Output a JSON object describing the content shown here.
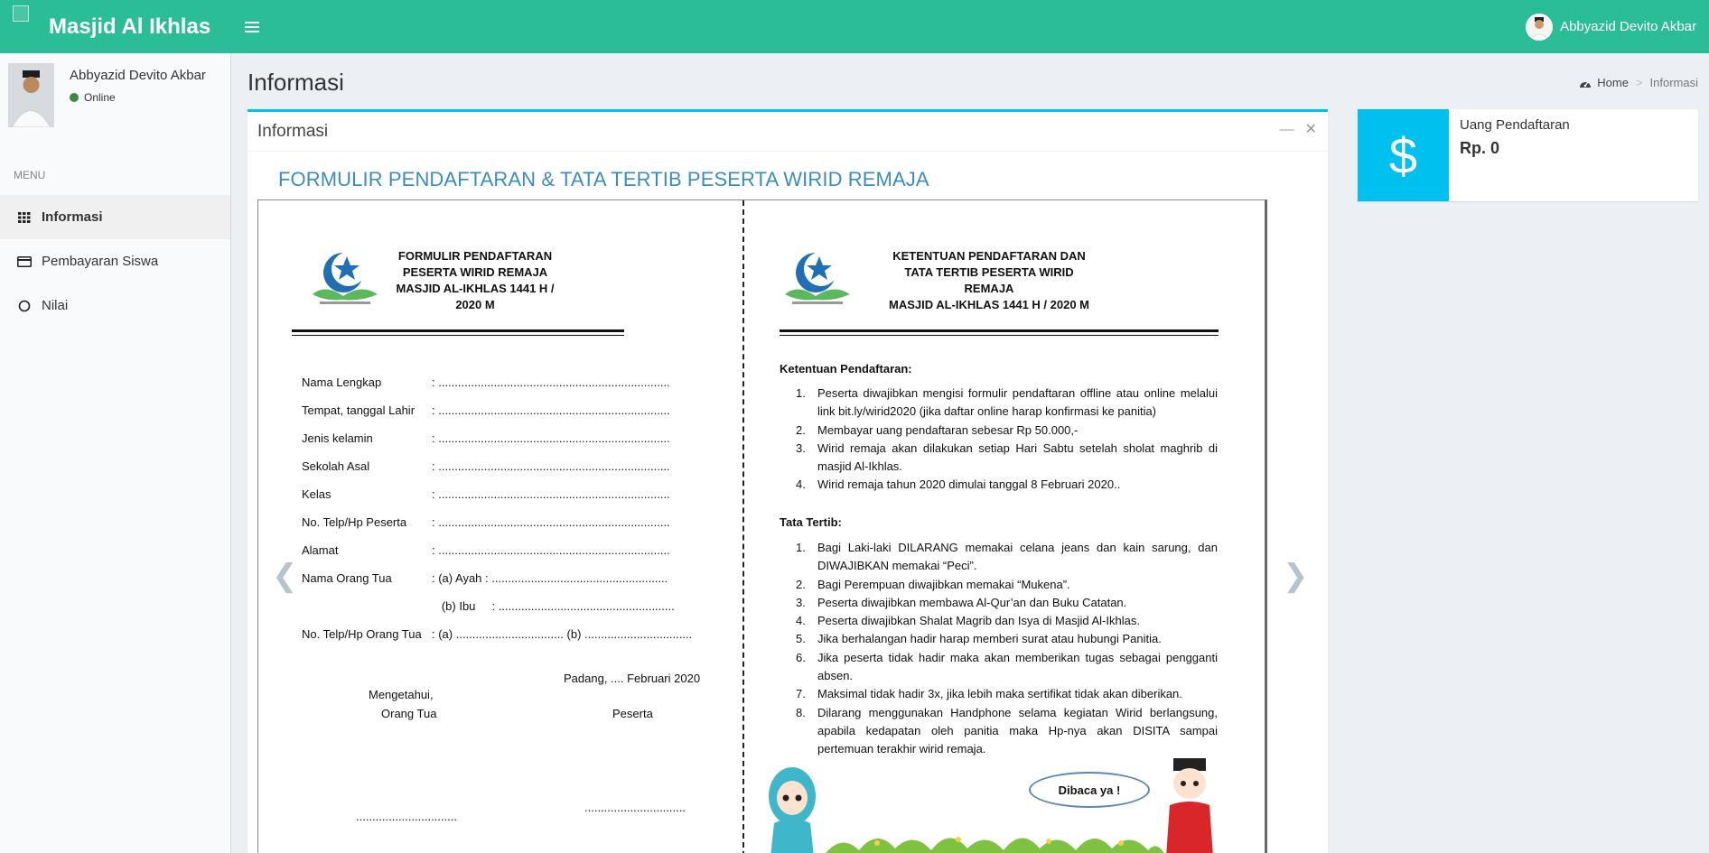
{
  "app": {
    "title": "Masjid Al Ikhlas"
  },
  "navbar": {
    "user_name": "Abbyazid Devito Akbar"
  },
  "sidebar": {
    "user_name": "Abbyazid Devito Akbar",
    "status": "Online",
    "menu_header": "MENU",
    "items": [
      {
        "label": "Informasi",
        "icon": "grid-icon",
        "active": true
      },
      {
        "label": "Pembayaran Siswa",
        "icon": "credit-card-icon",
        "active": false
      },
      {
        "label": "Nilai",
        "icon": "circle-icon",
        "active": false
      }
    ]
  },
  "page": {
    "title": "Informasi",
    "breadcrumb": {
      "home": "Home",
      "current": "Informasi"
    }
  },
  "box": {
    "title": "Informasi",
    "heading": "FORMULIR PENDAFTARAN & TATA TERTIB PESERTA WIRID REMAJA"
  },
  "doc_left": {
    "head": [
      "FORMULIR PENDAFTARAN",
      "PESERTA WIRID REMAJA",
      "MASJID AL-IKHLAS 1441 H / 2020 M"
    ],
    "fields": [
      {
        "label": "Nama Lengkap",
        "value": ": ......................................................................."
      },
      {
        "label": "Tempat, tanggal Lahir",
        "value": ": ......................................................................."
      },
      {
        "label": "Jenis kelamin",
        "value": ": ......................................................................."
      },
      {
        "label": "Sekolah Asal",
        "value": ": ......................................................................."
      },
      {
        "label": "Kelas",
        "value": ": ......................................................................."
      },
      {
        "label": "No. Telp/Hp Peserta",
        "value": ": ......................................................................."
      },
      {
        "label": "Alamat",
        "value": ": ......................................................................."
      },
      {
        "label": "Nama Orang Tua",
        "value": ": (a) Ayah   : ......................................................"
      },
      {
        "label": "",
        "value": "   (b) Ibu     : ......................................................"
      },
      {
        "label": "No. Telp/Hp Orang Tua",
        "value": ": (a) ................................. (b) ................................."
      }
    ],
    "date_line": "Padang,  ....  Februari 2020",
    "mengetahui": "Mengetahui,",
    "orang_tua": "Orang Tua",
    "peserta": "Peserta",
    "sign_left": "...............................",
    "sign_right": "..............................."
  },
  "doc_right": {
    "head": [
      "KETENTUAN PENDAFTARAN DAN",
      "TATA TERTIB PESERTA WIRID REMAJA",
      "MASJID AL-IKHLAS 1441 H / 2020 M"
    ],
    "ketentuan_title": "Ketentuan Pendaftaran:",
    "ketentuan": [
      "Peserta diwajibkan mengisi formulir pendaftaran offline atau online melalui link bit.ly/wirid2020 (jika daftar online harap konfirmasi ke panitia)",
      "Membayar uang pendaftaran sebesar Rp 50.000,-",
      "Wirid remaja akan dilakukan setiap Hari Sabtu setelah sholat maghrib di masjid Al-Ikhlas.",
      "Wirid remaja tahun 2020 dimulai tanggal 8 Februari 2020.."
    ],
    "tata_title": "Tata Tertib:",
    "tata": [
      "Bagi Laki-laki DILARANG memakai celana jeans dan kain sarung, dan DIWAJIBKAN memakai “Peci”.",
      "Bagi Perempuan diwajibkan memakai “Mukena”.",
      "Peserta diwajibkan membawa Al-Qur’an dan Buku Catatan.",
      "Peserta diwajibkan Shalat Magrib dan Isya di Masjid Al-Ikhlas.",
      "Jika berhalangan hadir harap memberi surat atau hubungi Panitia.",
      "Jika peserta tidak hadir maka akan memberikan tugas sebagai pengganti absen.",
      "Maksimal tidak hadir 3x, jika lebih maka sertifikat tidak akan diberikan.",
      "Dilarang menggunakan Handphone selama kegiatan Wirid berlangsung, apabila kedapatan oleh panitia maka Hp-nya akan DISITA sampai pertemuan terakhir wirid remaja."
    ],
    "bubble": "Dibaca ya !"
  },
  "infobox": {
    "label": "Uang Pendaftaran",
    "value": "Rp. 0",
    "icon": "dollar-icon"
  },
  "colors": {
    "navbar": "#2bbc98",
    "accent": "#00c0ef",
    "heading": "#3c8dbc"
  }
}
